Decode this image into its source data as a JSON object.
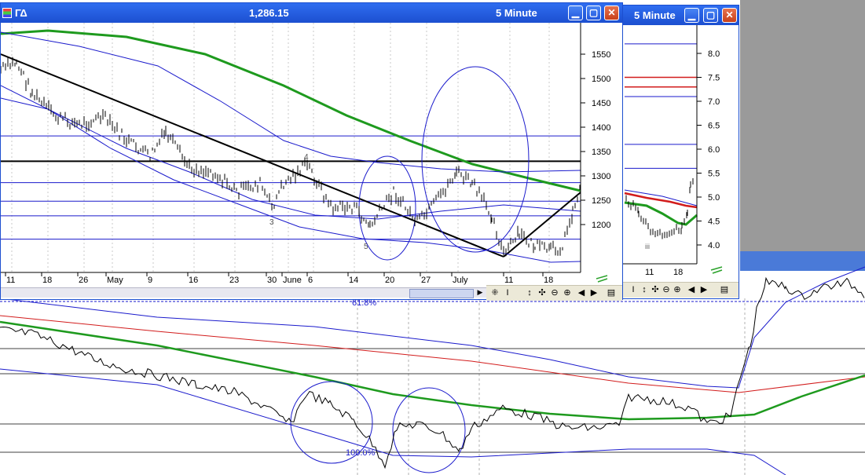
{
  "main_window": {
    "symbol": "ΓΔ",
    "price": "1,286.15",
    "interval": "5 Minute",
    "price_axis": [
      "1550",
      "1500",
      "1450",
      "1400",
      "1350",
      "1300",
      "1250",
      "1200"
    ],
    "date_axis": [
      "11",
      "18",
      "26",
      "May",
      "9",
      "16",
      "23",
      "30",
      "June",
      "6",
      "14",
      "20",
      "27",
      "July",
      "11",
      "18"
    ],
    "annotations": [
      "4",
      "3",
      "5"
    ]
  },
  "second_window": {
    "interval": "5 Minute",
    "value_axis": [
      "8.0",
      "7.5",
      "7.0",
      "6.5",
      "6.0",
      "5.5",
      "5.0",
      "4.5",
      "4.0"
    ],
    "date_axis": [
      "11",
      "18"
    ],
    "annotation": "iii"
  },
  "lower_chart": {
    "fib_labels": [
      "61.8%",
      "100.0%"
    ]
  },
  "toolbar_glyphs": [
    "I",
    "✣",
    "⊖",
    "⊕",
    "◀",
    "▶",
    "▤"
  ],
  "colors": {
    "titlebar": "#1c4fd0",
    "price_bars": "#000000",
    "ma_green": "#1e9a1e",
    "ma_red": "#d21c1c",
    "channel_blue": "#1a1acc"
  }
}
